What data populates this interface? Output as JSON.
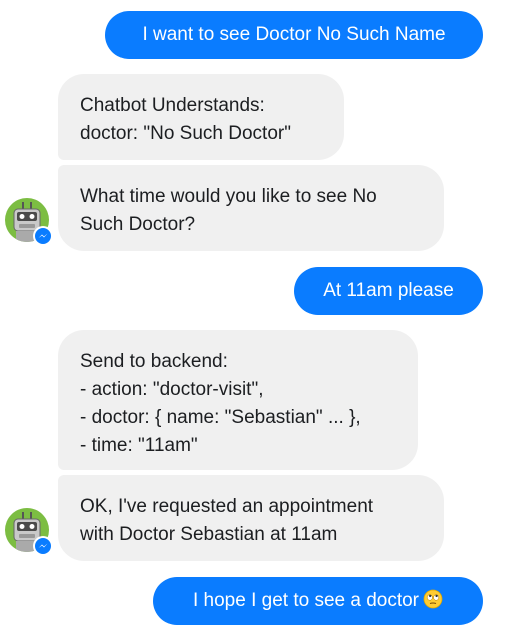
{
  "messages": [
    {
      "sender": "user",
      "text": "I want to see Doctor No Such Name"
    },
    {
      "sender": "bot",
      "text": "Chatbot Understands:\ndoctor: \"No Such Doctor\""
    },
    {
      "sender": "bot",
      "text": "What time would you like to see No\nSuch Doctor?"
    },
    {
      "sender": "user",
      "text": "At 11am please"
    },
    {
      "sender": "bot",
      "text": "Send to backend:\n- action: \"doctor-visit\",\n- doctor: { name: \"Sebastian\" ... },\n- time: \"11am\""
    },
    {
      "sender": "bot",
      "text": "OK, I've requested an appointment\nwith Doctor Sebastian at 11am"
    },
    {
      "sender": "user",
      "text": "I hope I get to see a doctor",
      "emoji": "face-with-rolling-eyes-icon"
    }
  ],
  "colors": {
    "outgoing_bubble": "#0a7cff",
    "incoming_bubble": "#f0f0f0",
    "avatar_bg": "#7cbd42",
    "messenger_badge": "#0a7cff"
  },
  "icons": {
    "avatar": "robot-avatar-icon",
    "badge": "messenger-badge-icon"
  }
}
